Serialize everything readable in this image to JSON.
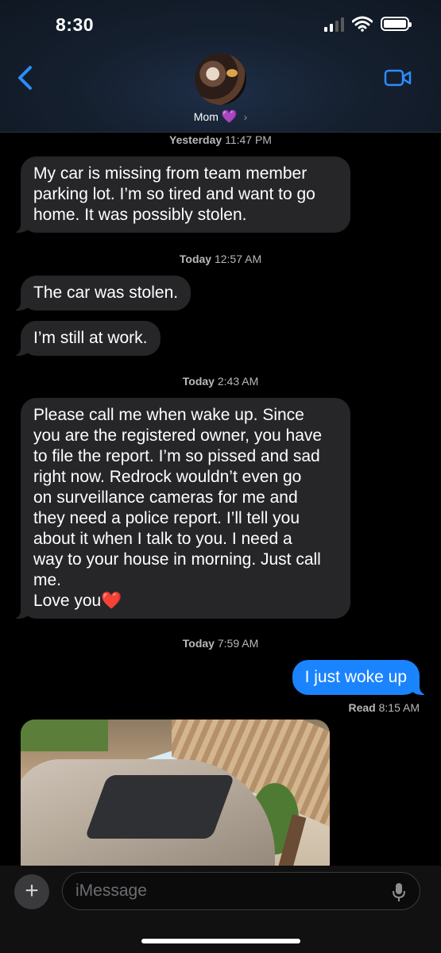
{
  "status_bar": {
    "time": "8:30"
  },
  "header": {
    "contact_name": "Mom",
    "contact_emoji": "💜",
    "chevron": "›"
  },
  "icons": {
    "back": "chevron-left-icon",
    "video": "video-camera-icon",
    "signal": "cellular-signal-icon",
    "wifi": "wifi-icon",
    "battery": "battery-icon",
    "plus": "plus-icon",
    "mic": "microphone-icon"
  },
  "colors": {
    "accent": "#1a84ff",
    "received_bubble": "#262628",
    "background": "#000000"
  },
  "messages": [
    {
      "kind": "timestamp",
      "day": "Yesterday",
      "time": "11:47 PM"
    },
    {
      "kind": "received",
      "text": "My car is missing from team member parking lot. I’m so tired and want to go home. It was possibly stolen."
    },
    {
      "kind": "timestamp",
      "day": "Today",
      "time": "12:57 AM"
    },
    {
      "kind": "received",
      "text": "The car was stolen."
    },
    {
      "kind": "received",
      "text": "I’m still at work."
    },
    {
      "kind": "timestamp",
      "day": "Today",
      "time": "2:43 AM"
    },
    {
      "kind": "received",
      "lines": [
        "Please call me when wake up. Since",
        "you are the registered owner, you have",
        "to file the report. I’m so pissed and sad",
        "right now. Redrock wouldn’t even go",
        "on surveillance cameras for me and",
        "they need a police report. I’ll tell you",
        "about it when I talk to you. I need a",
        "way to your house in morning. Just call",
        "me.",
        "Love you❤️"
      ]
    },
    {
      "kind": "timestamp",
      "day": "Today",
      "time": "7:59 AM"
    },
    {
      "kind": "sent",
      "text": "I just woke up"
    },
    {
      "kind": "receipt",
      "label": "Read",
      "time": "8:15 AM"
    },
    {
      "kind": "photo",
      "description": ""
    }
  ],
  "input": {
    "placeholder": "iMessage",
    "plus_label": "+"
  }
}
